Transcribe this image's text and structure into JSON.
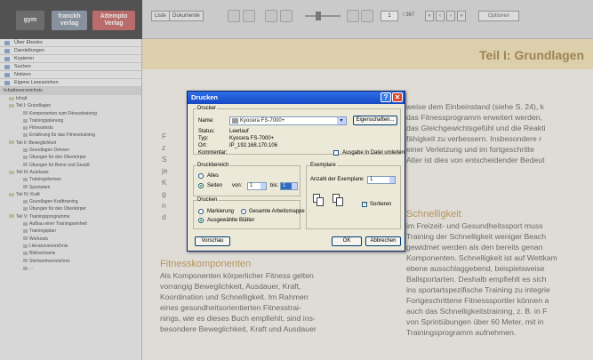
{
  "logos": {
    "gym": "gym",
    "franckh": "franckh verlag",
    "attempto": "Attempto Verlag"
  },
  "toolbar": {
    "list_label": "Liste",
    "docs_label": "Dokumente",
    "page_current": "1",
    "page_total": "/ 367",
    "search_label": "Optionen"
  },
  "sidebar": {
    "top_items": [
      "Über Ebooks",
      "Darstellungen",
      "Kopieren",
      "Suchen",
      "Notizen",
      "Eigene Lesezeichen"
    ],
    "contents_header": "Inhaltsverzeichnis",
    "tree": [
      {
        "level": 1,
        "label": "Inhalt"
      },
      {
        "level": 1,
        "label": "Teil I: Grundlagen"
      },
      {
        "level": 2,
        "label": "Komponenten zum Fitnesstraining"
      },
      {
        "level": 2,
        "label": "Trainingsplanung"
      },
      {
        "level": 2,
        "label": "Fitnesstests"
      },
      {
        "level": 2,
        "label": "Ernährung für das Fitnesstraining"
      },
      {
        "level": 1,
        "label": "Teil II: Beweglichkeit"
      },
      {
        "level": 2,
        "label": "Grundlagen Dehnen"
      },
      {
        "level": 2,
        "label": "Übungen für den Oberkörper"
      },
      {
        "level": 2,
        "label": "Übungen für Beine und Gesäß"
      },
      {
        "level": 1,
        "label": "Teil III: Ausdauer"
      },
      {
        "level": 2,
        "label": "Trainingsformen"
      },
      {
        "level": 2,
        "label": "Sportarten"
      },
      {
        "level": 1,
        "label": "Teil IV: Kraft"
      },
      {
        "level": 2,
        "label": "Grundlagen Krafttraining"
      },
      {
        "level": 2,
        "label": "Übungen für den Oberkörper"
      },
      {
        "level": 1,
        "label": "Teil V: Trainingsprogramme"
      },
      {
        "level": 2,
        "label": "Aufbau einer Trainingseinheit"
      },
      {
        "level": 2,
        "label": "Trainingsplan"
      },
      {
        "level": 2,
        "label": "Workouts"
      },
      {
        "level": 2,
        "label": "Literaturverzeichnis"
      },
      {
        "level": 2,
        "label": "Bildnachweis"
      },
      {
        "level": 2,
        "label": "Stichwortverzeichnis"
      },
      {
        "level": 2,
        "label": "..."
      }
    ]
  },
  "page": {
    "chapter_title": "Teil I: Grundlagen",
    "right_col_1": [
      "weise dem Einbeinstand (siehe S. 24), k",
      "das Fitnessprogramm erweitert werden,",
      "das Gleichgewichtsgefühl und die Reakti",
      "fähigkeit zu verbessern. Insbesondere r",
      "einer Verletzung und im fortgeschritte",
      "Alter ist dies von entscheidender Bedeut"
    ],
    "right_heading": "Schnelligkeit",
    "right_col_2": [
      "im Freizeit- und Gesundheitssport muss",
      "Training der Schnelligkeit weniger Beach",
      "gewidmet werden als den bereits genan",
      "Komponenten. Schnelligkeit ist auf Wettkam",
      "ebene ausschlaggebend, beispielsweise",
      "Ballsportarten. Deshalb empfiehlt es sich",
      "ins sportartspezifische Training zu integrie",
      "Fortgeschrittene Fitnesssportler können a",
      "auch das Schnelligkeitstraining, z. B. in F",
      "von Sprintübungen über 60 Meter, mit in",
      "Trainingsprogramm aufnehmen."
    ],
    "left_heading": "Fitnesskomponenten",
    "left_col": [
      "Als Komponenten körperlicher Fitness gelten",
      "vorrangig Beweglichkeit, Ausdauer, Kraft,",
      "Koordination und Schnelligkeit. Im Rahmen",
      "eines gesundheitsorientierten Fitnesstrai-",
      "nings, wie es dieses Buch empfiehlt, sind ins-",
      "besondere Beweglichkeit, Kraft und Ausdauer"
    ],
    "left_fragments": [
      "F",
      "z",
      "S",
      "je",
      "K",
      "g",
      "n",
      "d"
    ]
  },
  "dialog": {
    "title": "Drucken",
    "help_glyph": "?",
    "close_glyph": "✕",
    "printer_group": "Drucker",
    "name_label": "Name:",
    "printer_name": "Kyocera FS-7000+",
    "properties_button": "Eigenschaften...",
    "status_label": "Status:",
    "status_value": "Leerlauf",
    "type_label": "Typ:",
    "type_value": "Kyocera FS-7000+",
    "location_label": "Ort:",
    "location_value": "IP_192.168.170.106",
    "comment_label": "Kommentar:",
    "print_to_file_label": "Ausgabe in Datei umleiten",
    "print_to_file_checked": false,
    "range_group": "Druckbereich",
    "range_all_label": "Alles",
    "range_pages_label": "Seiten",
    "range_selected": "pages",
    "from_label": "von:",
    "from_value": "1",
    "to_label": "bis:",
    "to_value": "1",
    "print_group": "Drucken",
    "print_selection_label": "Markierung",
    "print_workbook_label": "Gesamte Arbeitsmappe",
    "print_sheets_label": "Ausgewählte Blätter",
    "print_selected": "sheets",
    "copies_group": "Exemplare",
    "copies_label": "Anzahl der Exemplare:",
    "copies_value": "1",
    "collate_label": "Sortieren",
    "collate_checked": true,
    "preview_button": "Vorschau",
    "ok_button": "OK",
    "cancel_button": "Abbrechen"
  }
}
